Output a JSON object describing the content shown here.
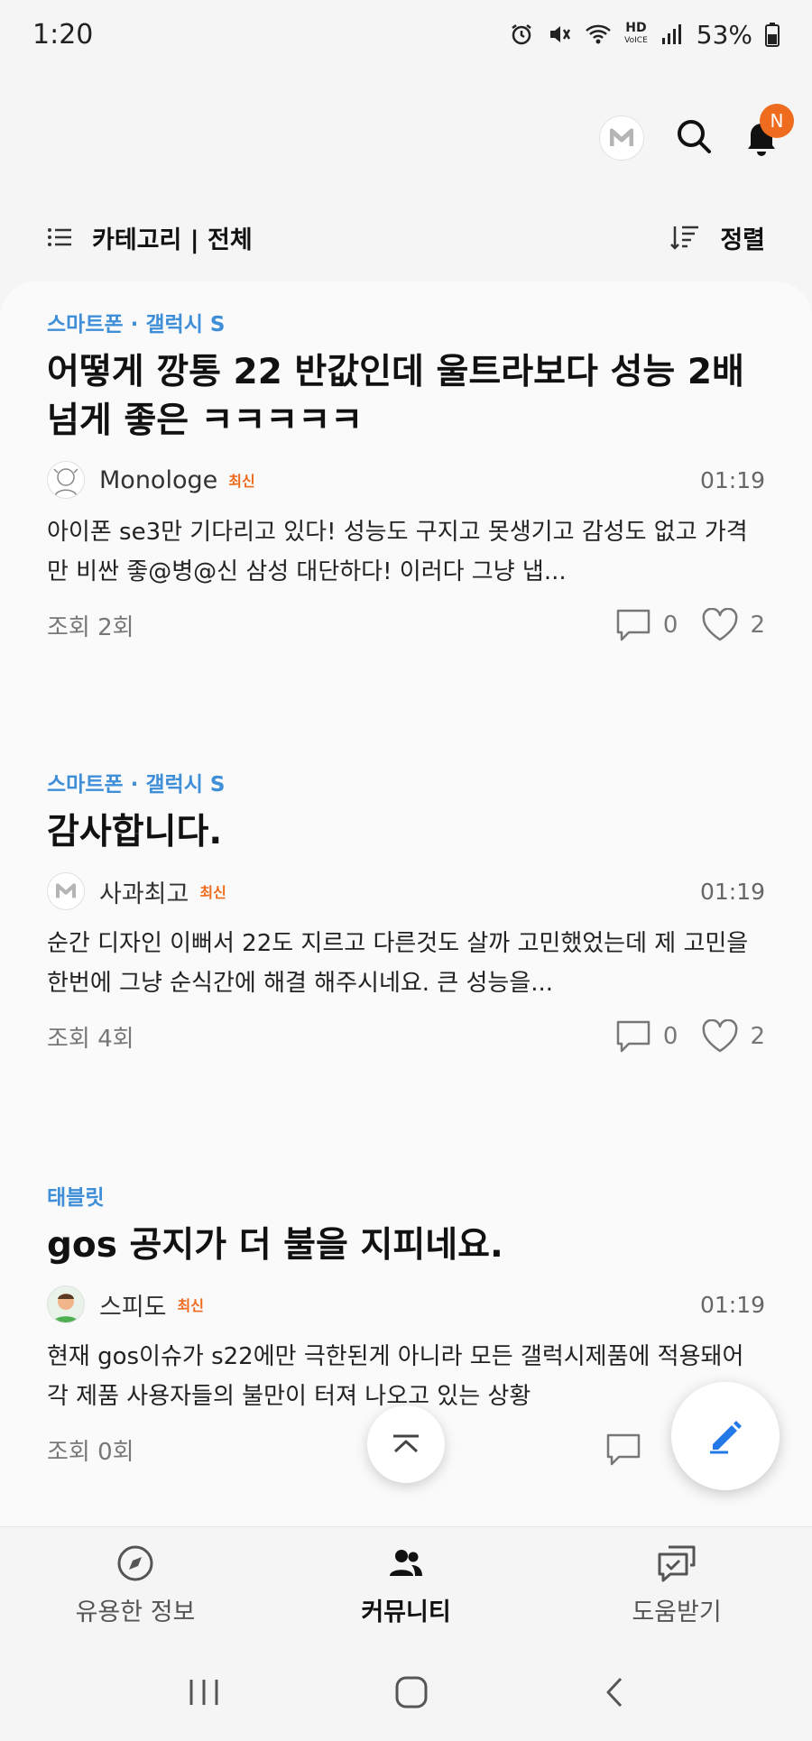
{
  "status_bar": {
    "time": "1:20",
    "hd_label": "HD",
    "voice_label": "VoICE",
    "battery": "53%"
  },
  "header": {
    "notification_badge": "N"
  },
  "category_bar": {
    "label": "카테고리 | 전체",
    "sort_label": "정렬"
  },
  "posts": [
    {
      "category": "스마트폰 · 갤럭시 S",
      "title": "어떻게 깡통 22 반값인데 울트라보다 성능 2배 넘게 좋은 ㅋㅋㅋㅋㅋ",
      "author": "Monologe",
      "badge": "최신",
      "time": "01:19",
      "excerpt": "아이폰 se3만 기다리고 있다! 성능도 구지고 못생기고 감성도 없고 가격만 비싼 좋@병@신 삼성 대단하다! 이러다 그냥 냅...",
      "views": "조회 2회",
      "comments": "0",
      "likes": "2"
    },
    {
      "category": "스마트폰 · 갤럭시 S",
      "title": "감사합니다.",
      "author": "사과최고",
      "badge": "최신",
      "time": "01:19",
      "excerpt": "순간 디자인 이뻐서 22도 지르고 다른것도 살까 고민했었는데 제 고민을 한번에 그냥 순식간에 해결 해주시네요. 큰 성능을...",
      "views": "조회 4회",
      "comments": "0",
      "likes": "2"
    },
    {
      "category": "태블릿",
      "title": "gos 공지가 더 불을 지피네요.",
      "author": "스피도",
      "badge": "최신",
      "time": "01:19",
      "excerpt": "현재 gos이슈가 s22에만 극한된게 아니라 모든 갤럭시제품에 적용돼어 각 제품 사용자들의 불만이 터져 나오고 있는 상황",
      "views": "조회 0회",
      "comments": "",
      "likes": ""
    }
  ],
  "bottom_nav": {
    "tabs": [
      {
        "label": "유용한 정보",
        "icon": "compass-icon"
      },
      {
        "label": "커뮤니티",
        "icon": "people-icon"
      },
      {
        "label": "도움받기",
        "icon": "chat-bubbles-icon"
      }
    ],
    "active_index": 1
  },
  "colors": {
    "accent_blue": "#3e8ed8",
    "badge_orange": "#ef6b1e",
    "fab_pen": "#2379e8"
  }
}
